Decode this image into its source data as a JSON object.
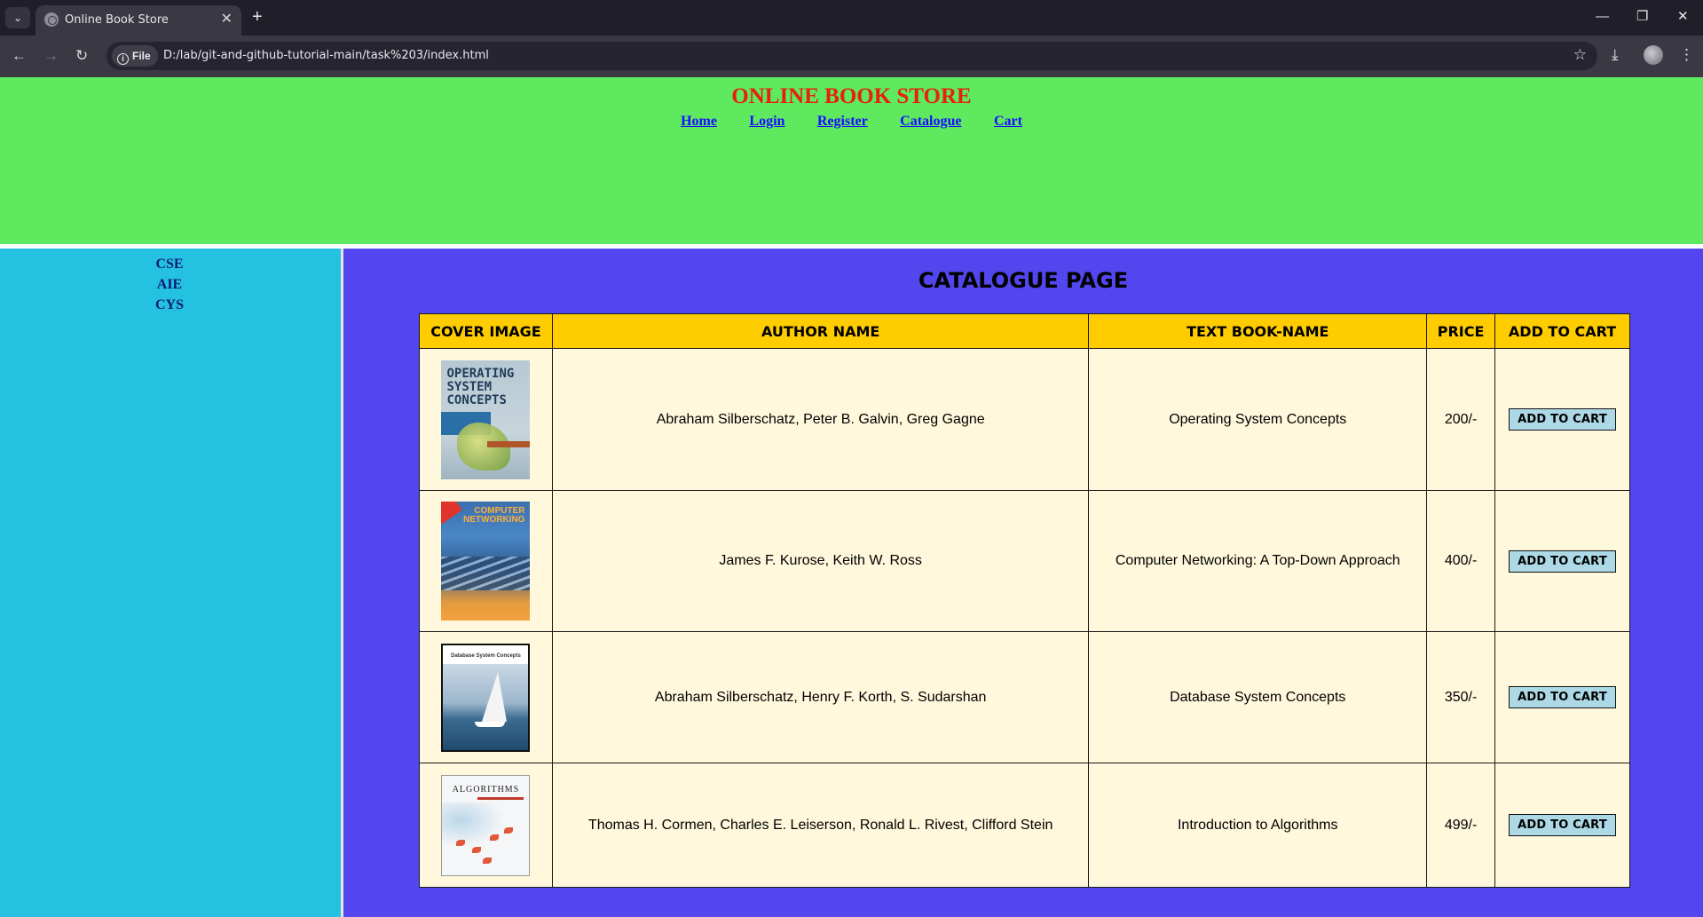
{
  "browser": {
    "tab_title": "Online Book Store",
    "tab_close": "✕",
    "new_tab": "+",
    "url_chip": "File",
    "url": "D:/lab/git-and-github-tutorial-main/task%203/index.html"
  },
  "site": {
    "title": "ONLINE BOOK STORE",
    "nav": [
      "Home",
      "Login",
      "Register",
      "Catalogue",
      "Cart"
    ]
  },
  "sidebar": {
    "items": [
      "CSE",
      "AIE",
      "CYS"
    ]
  },
  "catalogue": {
    "heading": "CATALOGUE PAGE",
    "columns": [
      "COVER IMAGE",
      "AUTHOR NAME",
      "TEXT BOOK-NAME",
      "PRICE",
      "ADD TO CART"
    ],
    "rows": [
      {
        "cover_text": "OPERATING SYSTEM CONCEPTS",
        "author": "Abraham Silberschatz, Peter B. Galvin, Greg Gagne",
        "title": "Operating System Concepts",
        "price": "200/-",
        "button": "ADD TO CART"
      },
      {
        "cover_text": "COMPUTER NETWORKING",
        "author": "James F. Kurose, Keith W. Ross",
        "title": "Computer Networking: A Top-Down Approach",
        "price": "400/-",
        "button": "ADD TO CART"
      },
      {
        "cover_text": "Database System Concepts",
        "author": "Abraham Silberschatz, Henry F. Korth, S. Sudarshan",
        "title": "Database System Concepts",
        "price": "350/-",
        "button": "ADD TO CART"
      },
      {
        "cover_text": "ALGORITHMS",
        "author": "Thomas H. Cormen, Charles E. Leiserson, Ronald L. Rivest, Clifford Stein",
        "title": "Introduction to Algorithms",
        "price": "499/-",
        "button": "ADD TO CART"
      }
    ]
  },
  "colors": {
    "header_bg": "#5ee95f",
    "title_red": "#e8200f",
    "sidebar_bg": "#25c1e1",
    "main_bg": "#5247ef",
    "table_header": "#ffcc00",
    "table_body": "#fff8dc",
    "button_bg": "#add8e6"
  }
}
